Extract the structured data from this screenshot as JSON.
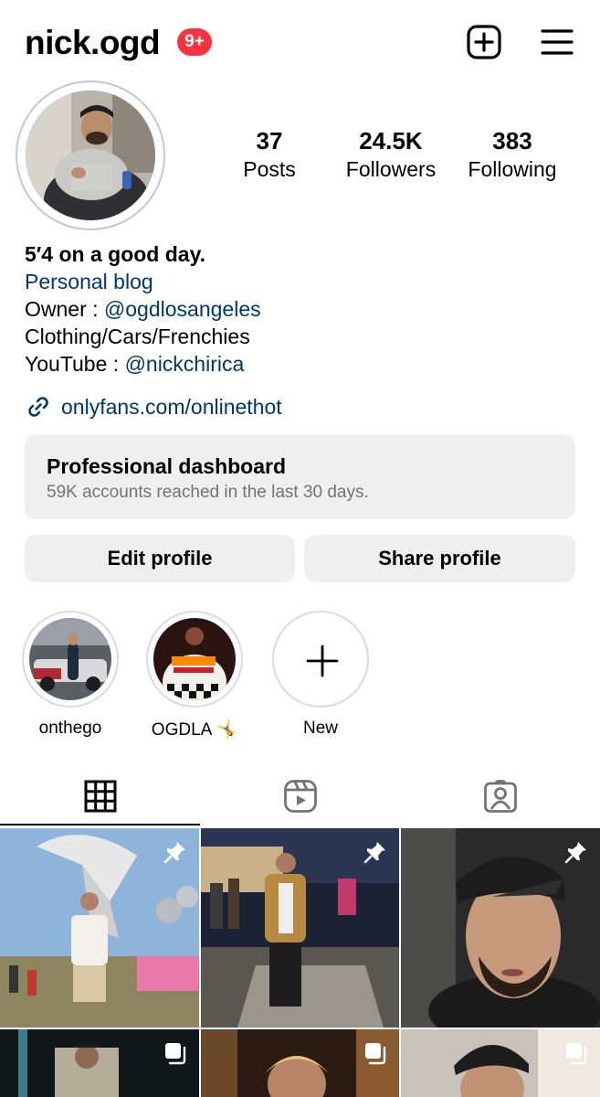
{
  "header": {
    "username": "nick.ogd",
    "notification_badge": "9+",
    "add_icon": "plus-square-icon",
    "menu_icon": "hamburger-menu-icon"
  },
  "profile": {
    "stats": [
      {
        "value": "37",
        "label": "Posts"
      },
      {
        "value": "24.5K",
        "label": "Followers"
      },
      {
        "value": "383",
        "label": "Following"
      }
    ]
  },
  "bio": {
    "name": "5′4 on a good day.",
    "category": "Personal blog",
    "line1_prefix": "Owner : ",
    "line1_mention": "@ogdlosangeles",
    "line2": "Clothing/Cars/Frenchies",
    "line3_prefix": "YouTube : ",
    "line3_mention": "@nickchirica",
    "link": "onlyfans.com/onlinethot"
  },
  "dashboard": {
    "title": "Professional dashboard",
    "subtitle": "59K accounts reached in the last 30 days."
  },
  "buttons": {
    "edit": "Edit profile",
    "share": "Share profile"
  },
  "highlights": [
    {
      "label": "onthego"
    },
    {
      "label": "OGDLA 🤸"
    },
    {
      "label": "New"
    }
  ],
  "tabs": [
    {
      "icon": "grid-icon",
      "active": true
    },
    {
      "icon": "reels-icon",
      "active": false
    },
    {
      "icon": "tagged-icon",
      "active": false
    }
  ],
  "posts": [
    {
      "pinned": true
    },
    {
      "pinned": true
    },
    {
      "pinned": true
    },
    {
      "multi": true
    },
    {
      "multi": true
    },
    {
      "multi": true
    }
  ],
  "colors": {
    "link_blue": "#00376b",
    "badge_red": "#ff3040",
    "button_gray": "#efefef",
    "secondary_text": "#737373"
  }
}
